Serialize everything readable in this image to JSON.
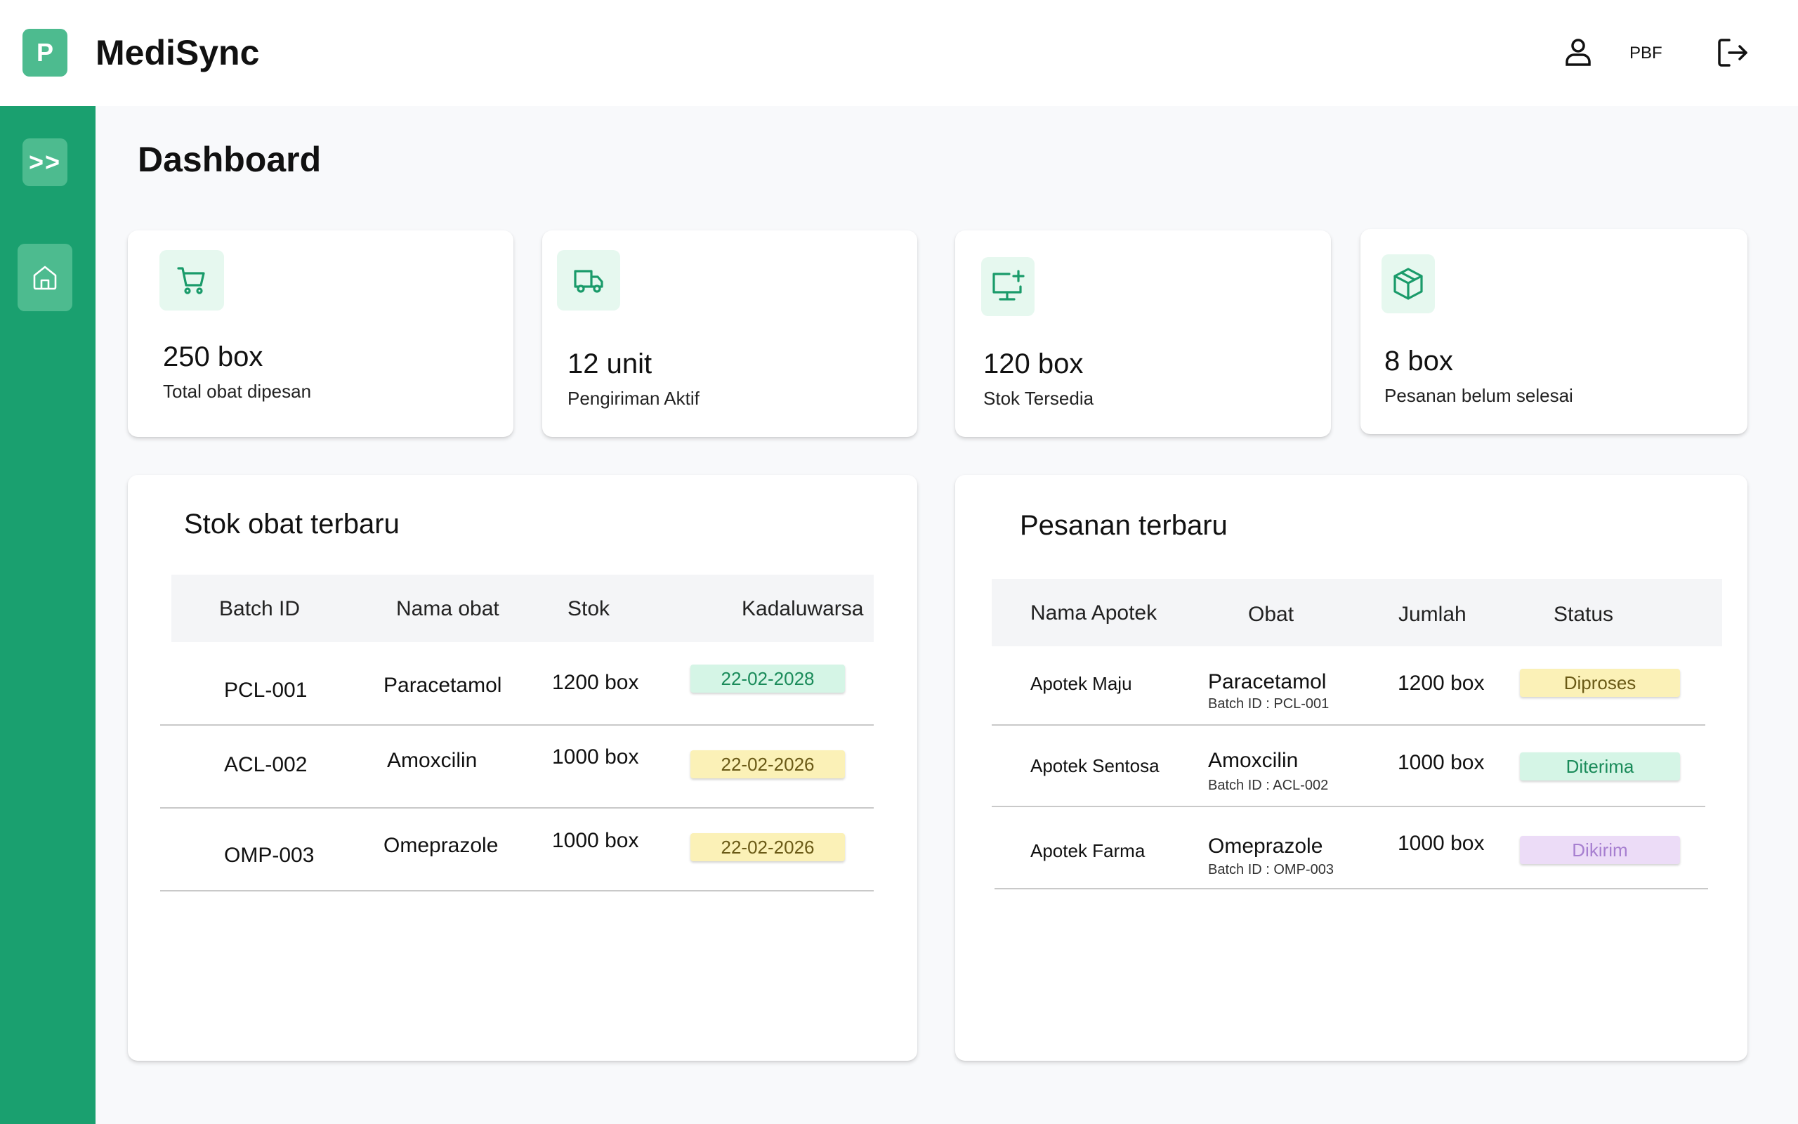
{
  "header": {
    "logo_letter": "P",
    "app_name": "MediSync",
    "user_label": "PBF",
    "user_icon": "user-icon",
    "logout_icon": "logout-icon"
  },
  "sidebar": {
    "toggle_label": ">>",
    "items": [
      {
        "icon": "home-icon",
        "label": ""
      }
    ]
  },
  "page": {
    "title": "Dashboard"
  },
  "stats": [
    {
      "icon": "cart-icon",
      "value": "250 box",
      "label": "Total obat dipesan"
    },
    {
      "icon": "truck-icon",
      "value": "12 unit",
      "label": "Pengiriman Aktif"
    },
    {
      "icon": "monitor-plus-icon",
      "value": "120 box",
      "label": "Stok Tersedia"
    },
    {
      "icon": "package-icon",
      "value": "8 box",
      "label": "Pesanan belum selesai"
    }
  ],
  "stock_table": {
    "title": "Stok obat terbaru",
    "headers": [
      "Batch ID",
      "Nama obat",
      "Stok",
      "Kadaluwarsa"
    ],
    "rows": [
      {
        "batch": "PCL-001",
        "name": "Paracetamol",
        "stock": "1200 box",
        "expiry": "22-02-2028",
        "expiry_status": "green"
      },
      {
        "batch": "ACL-002",
        "name": "Amoxcilin",
        "stock": "1000 box",
        "expiry": "22-02-2026",
        "expiry_status": "yellow"
      },
      {
        "batch": "OMP-003",
        "name": "Omeprazole",
        "stock": "1000 box",
        "expiry": "22-02-2026",
        "expiry_status": "yellow"
      }
    ]
  },
  "orders_table": {
    "title": "Pesanan terbaru",
    "headers": [
      "Nama Apotek",
      "Obat",
      "Jumlah",
      "Status"
    ],
    "rows": [
      {
        "pharmacy": "Apotek Maju",
        "drug": "Paracetamol",
        "batch": "Batch ID : PCL-001",
        "qty": "1200 box",
        "status": "Diproses",
        "status_color": "yellow"
      },
      {
        "pharmacy": "Apotek Sentosa",
        "drug": "Amoxcilin",
        "batch": "Batch ID : ACL-002",
        "qty": "1000 box",
        "status": "Diterima",
        "status_color": "green"
      },
      {
        "pharmacy": "Apotek Farma",
        "drug": "Omeprazole",
        "batch": "Batch ID : OMP-003",
        "qty": "1000 box",
        "status": "Dikirim",
        "status_color": "purple"
      }
    ]
  },
  "colors": {
    "brand_green": "#1aa06f",
    "brand_light": "#4dbb8f",
    "icon_green": "#1a9b6a",
    "badge_green": "#d5f5e6",
    "badge_yellow": "#fbf1b7",
    "badge_purple": "#ecdcf7"
  }
}
